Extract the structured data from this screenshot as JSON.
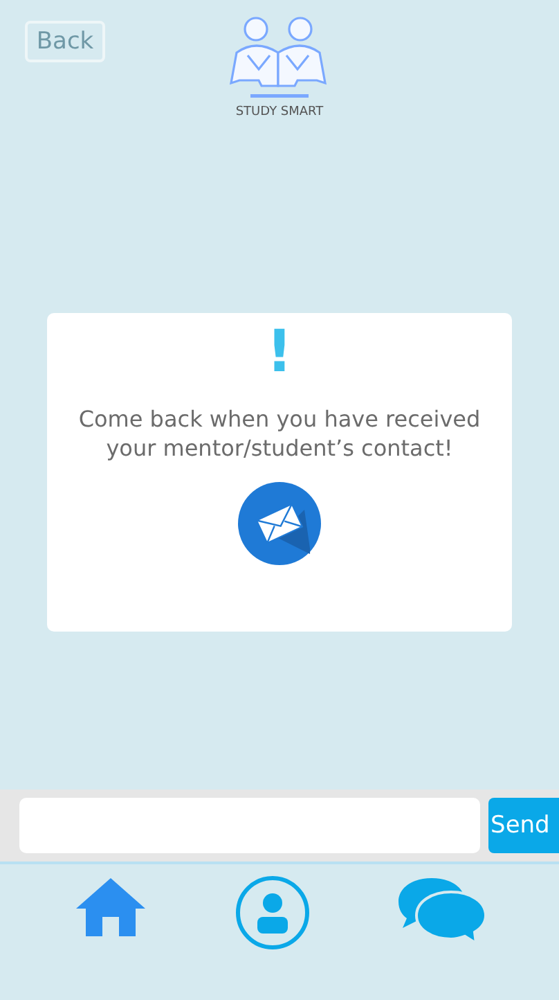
{
  "header": {
    "back_button": "Back",
    "logo_text": "STUDY SMART"
  },
  "notice": {
    "mark": "!",
    "message": "Come back when you have received your mentor/student’s contact!"
  },
  "composer": {
    "send_button": "Send"
  }
}
